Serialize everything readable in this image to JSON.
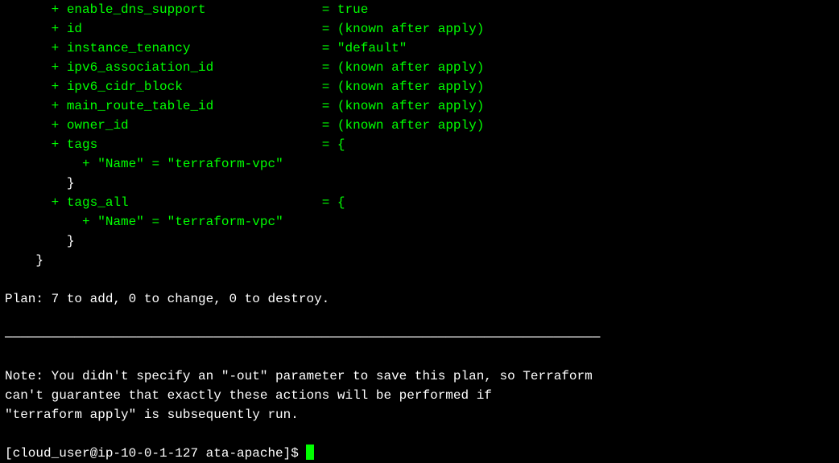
{
  "attributes": [
    {
      "indent": "      ",
      "key": "enable_dns_support",
      "eq_indent": "               ",
      "value": "true"
    },
    {
      "indent": "      ",
      "key": "id",
      "eq_indent": "                               ",
      "value": "(known after apply)"
    },
    {
      "indent": "      ",
      "key": "instance_tenancy",
      "eq_indent": "                 ",
      "value": "\"default\""
    },
    {
      "indent": "      ",
      "key": "ipv6_association_id",
      "eq_indent": "              ",
      "value": "(known after apply)"
    },
    {
      "indent": "      ",
      "key": "ipv6_cidr_block",
      "eq_indent": "                  ",
      "value": "(known after apply)"
    },
    {
      "indent": "      ",
      "key": "main_route_table_id",
      "eq_indent": "              ",
      "value": "(known after apply)"
    },
    {
      "indent": "      ",
      "key": "owner_id",
      "eq_indent": "                         ",
      "value": "(known after apply)"
    }
  ],
  "tags_block": {
    "indent": "      ",
    "key": "tags",
    "eq_indent": "                             ",
    "open_brace": "{",
    "nested": {
      "indent": "          ",
      "key": "\"Name\"",
      "value": "= \"terraform-vpc\""
    },
    "close_indent": "        ",
    "close_brace": "}"
  },
  "tags_all_block": {
    "indent": "      ",
    "key": "tags_all",
    "eq_indent": "                         ",
    "open_brace": "{",
    "nested": {
      "indent": "          ",
      "key": "\"Name\"",
      "value": "= \"terraform-vpc\""
    },
    "close_indent": "        ",
    "close_brace": "}"
  },
  "closing_brace": {
    "indent": "    ",
    "brace": "}"
  },
  "plan": {
    "label": "Plan:",
    "text": " 7 to add, 0 to change, 0 to destroy."
  },
  "divider": "─────────────────────────────────────────────────────────────────────────────",
  "note": {
    "line1": "Note: You didn't specify an \"-out\" parameter to save this plan, so Terraform",
    "line2": "can't guarantee that exactly these actions will be performed if",
    "line3": "\"terraform apply\" is subsequently run."
  },
  "prompt": {
    "text": "[cloud_user@ip-10-0-1-127 ata-apache]$ "
  },
  "plus": "+",
  "eq": "="
}
